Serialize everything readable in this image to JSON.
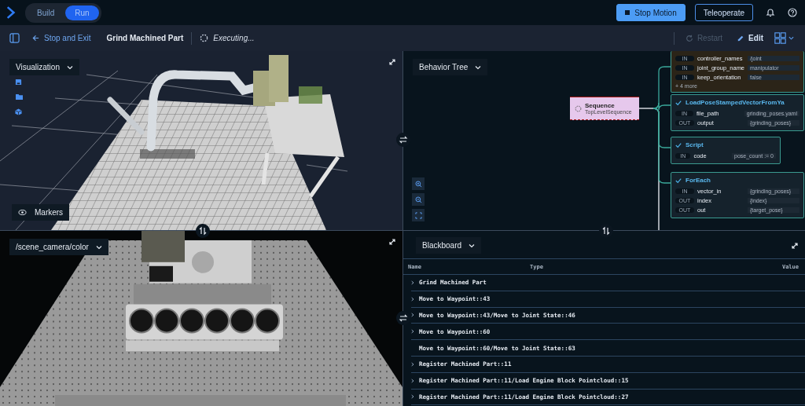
{
  "top_bar": {
    "modes": [
      {
        "label": "Build",
        "selected": false
      },
      {
        "label": "Run",
        "selected": true
      }
    ],
    "buttons": [
      {
        "label": "Stop Motion",
        "kind": "primary"
      },
      {
        "label": "Teleoperate",
        "kind": "outline"
      }
    ]
  },
  "toolbar": {
    "back_link": "Stop and Exit",
    "objective_title": "Grind Machined Part",
    "status": "Executing...",
    "actions": [
      {
        "label": "Restart",
        "kind": "restart",
        "disabled": true
      },
      {
        "label": "Edit",
        "kind": "edit",
        "disabled": false
      }
    ]
  },
  "visualization": {
    "dropdown": "Visualization",
    "markers_button": "Markers"
  },
  "behavior_tree": {
    "dropdown": "Behavior Tree",
    "root": {
      "title": "Sequence",
      "subtitle": "TopLevelSequence"
    },
    "nodes": [
      {
        "succeeded": false,
        "ports": [
          {
            "direction": "IN",
            "name": "controller_names",
            "value": "/joint"
          },
          {
            "direction": "IN",
            "name": "joint_group_name",
            "value": "manipulator"
          },
          {
            "direction": "IN",
            "name": "keep_orientation",
            "value": "false"
          }
        ],
        "more": "+ 4 more"
      },
      {
        "succeeded": true,
        "title": "LoadPoseStampedVectorFromYa",
        "ports": [
          {
            "direction": "IN",
            "name": "file_path",
            "value": "grinding_poses.yaml"
          },
          {
            "direction": "OUT",
            "name": "output",
            "value": "{grinding_poses}"
          }
        ]
      },
      {
        "succeeded": true,
        "title": "Script",
        "ports": [
          {
            "direction": "IN",
            "name": "code",
            "value": "pose_count := 0"
          }
        ]
      },
      {
        "succeeded": true,
        "title": "ForEach",
        "ports": [
          {
            "direction": "IN",
            "name": "vector_in",
            "value": "{grinding_poses}"
          },
          {
            "direction": "OUT",
            "name": "index",
            "value": "{index}"
          },
          {
            "direction": "OUT",
            "name": "out",
            "value": "{target_pose}"
          }
        ]
      }
    ]
  },
  "camera": {
    "dropdown": "/scene_camera/color"
  },
  "blackboard": {
    "dropdown": "Blackboard",
    "columns": [
      "Name",
      "Type",
      "Value"
    ],
    "rows": [
      {
        "name": "Grind Machined Part",
        "expandable": true
      },
      {
        "name": "Move to Waypoint::43",
        "expandable": true
      },
      {
        "name": "Move to Waypoint::43/Move to Joint State::46",
        "expandable": true
      },
      {
        "name": "Move to Waypoint::60",
        "expandable": true
      },
      {
        "name": "Move to Waypoint::60/Move to Joint State::63",
        "expandable": false
      },
      {
        "name": "Register Machined Part::11",
        "expandable": true
      },
      {
        "name": "Register Machined Part::11/Load Engine Block Pointcloud::15",
        "expandable": true
      },
      {
        "name": "Register Machined Part::11/Load Engine Block Pointcloud::27",
        "expandable": true
      }
    ]
  }
}
